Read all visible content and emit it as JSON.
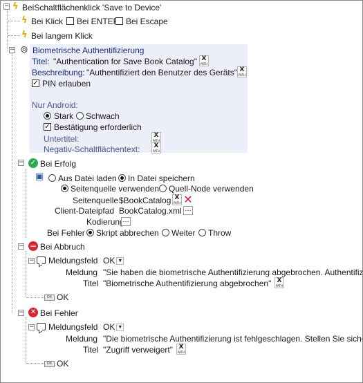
{
  "root": {
    "label": "BeiSchaltflächenklick 'Save to Device'"
  },
  "on_click": {
    "label": "Bei Klick",
    "enter_label": "Bei ENTER",
    "escape_label": "Bei Escape",
    "enter_checked": false,
    "escape_checked": false
  },
  "long_click": {
    "label": "Bei langem Klick"
  },
  "biometric": {
    "label": "Biometrische Authentifizierung",
    "title_label": "Titel:",
    "title_value": "\"Authentication for Save Book Catalog\"",
    "desc_label": "Beschreibung:",
    "desc_value": "\"Authentifiziert den Benutzer des Geräts\"",
    "allow_pin_label": "PIN erlauben",
    "allow_pin_checked": true,
    "android_only_label": "Nur Android:",
    "strong_label": "Stark",
    "weak_label": "Schwach",
    "strength_selected": "strong",
    "confirm_label": "Bestätigung erforderlich",
    "confirm_checked": true,
    "subtitle_label": "Untertitel:",
    "negative_label": "Negativ-Schaltflächentext:"
  },
  "success": {
    "label": "Bei Erfolg",
    "load_label": "Aus Datei laden",
    "save_label": "In Datei speichern",
    "mode_selected": "save",
    "page_source_label": "Seitenquelle verwenden",
    "source_node_label": "Quell-Node verwenden",
    "source_selected": "page",
    "page_source_field_label": "Seitenquelle",
    "page_source_value": "$BookCatalog",
    "client_path_label": "Client-Dateipfad",
    "client_path_value": "BookCatalog.xml",
    "encoding_label": "Kodierung",
    "on_error_label": "Bei Fehler",
    "abort_label": "Skript abbrechen",
    "continue_label": "Weiter",
    "throw_label": "Throw",
    "error_selected": "abort"
  },
  "cancel": {
    "label": "Bei Abbruch",
    "msgbox_label": "Meldungsfeld",
    "msgbox_value": "OK",
    "message_label": "Meldung",
    "message_value": "\"Sie haben die biometrische Authentifizierung abgebrochen. Authentifizi",
    "title_label": "Titel",
    "title_value": "\"Biometrische Authentifizierung abgebrochen\"",
    "ok_label": "OK"
  },
  "error": {
    "label": "Bei Fehler",
    "msgbox_label": "Meldungsfeld",
    "msgbox_value": "OK",
    "message_label": "Meldung",
    "message_value": "\"Die biometrische Authentifizierung ist fehlgeschlagen. Stellen Sie siche",
    "title_label": "Titel",
    "title_value": "\"Zugriff verweigert\"",
    "ok_label": "OK"
  },
  "xpath_button": {
    "top": "X",
    "bottom": "PATH"
  },
  "colors": {
    "bolt": "#e8a400",
    "success": "#2fa84f",
    "abort": "#d8262f",
    "error": "#d8262f",
    "panel": "#eceef8"
  }
}
